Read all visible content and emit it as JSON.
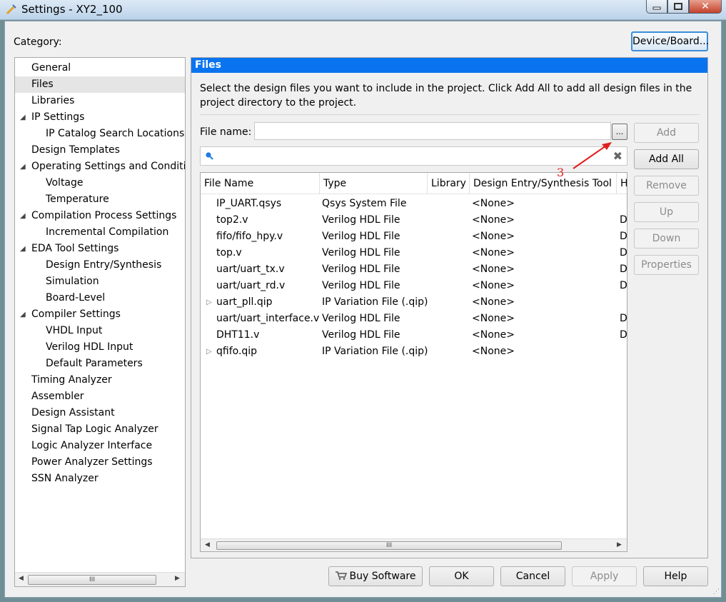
{
  "window": {
    "title": "Settings - XY2_100"
  },
  "category_label": "Category:",
  "device_board_button": "Device/Board...",
  "tree": [
    {
      "label": "General",
      "indent": 0,
      "expander": false,
      "selected": false
    },
    {
      "label": "Files",
      "indent": 0,
      "expander": false,
      "selected": true
    },
    {
      "label": "Libraries",
      "indent": 0,
      "expander": false,
      "selected": false
    },
    {
      "label": "IP Settings",
      "indent": 0,
      "expander": true,
      "selected": false
    },
    {
      "label": "IP Catalog Search Locations",
      "indent": 1,
      "expander": false,
      "selected": false
    },
    {
      "label": "Design Templates",
      "indent": 0,
      "expander": false,
      "selected": false
    },
    {
      "label": "Operating Settings and Conditic",
      "indent": 0,
      "expander": true,
      "selected": false
    },
    {
      "label": "Voltage",
      "indent": 1,
      "expander": false,
      "selected": false
    },
    {
      "label": "Temperature",
      "indent": 1,
      "expander": false,
      "selected": false
    },
    {
      "label": "Compilation Process Settings",
      "indent": 0,
      "expander": true,
      "selected": false
    },
    {
      "label": "Incremental Compilation",
      "indent": 1,
      "expander": false,
      "selected": false
    },
    {
      "label": "EDA Tool Settings",
      "indent": 0,
      "expander": true,
      "selected": false
    },
    {
      "label": "Design Entry/Synthesis",
      "indent": 1,
      "expander": false,
      "selected": false
    },
    {
      "label": "Simulation",
      "indent": 1,
      "expander": false,
      "selected": false
    },
    {
      "label": "Board-Level",
      "indent": 1,
      "expander": false,
      "selected": false
    },
    {
      "label": "Compiler Settings",
      "indent": 0,
      "expander": true,
      "selected": false
    },
    {
      "label": "VHDL Input",
      "indent": 1,
      "expander": false,
      "selected": false
    },
    {
      "label": "Verilog HDL Input",
      "indent": 1,
      "expander": false,
      "selected": false
    },
    {
      "label": "Default Parameters",
      "indent": 1,
      "expander": false,
      "selected": false
    },
    {
      "label": "Timing Analyzer",
      "indent": 0,
      "expander": false,
      "selected": false
    },
    {
      "label": "Assembler",
      "indent": 0,
      "expander": false,
      "selected": false
    },
    {
      "label": "Design Assistant",
      "indent": 0,
      "expander": false,
      "selected": false
    },
    {
      "label": "Signal Tap Logic Analyzer",
      "indent": 0,
      "expander": false,
      "selected": false
    },
    {
      "label": "Logic Analyzer Interface",
      "indent": 0,
      "expander": false,
      "selected": false
    },
    {
      "label": "Power Analyzer Settings",
      "indent": 0,
      "expander": false,
      "selected": false
    },
    {
      "label": "SSN Analyzer",
      "indent": 0,
      "expander": false,
      "selected": false
    }
  ],
  "files_panel": {
    "header": "Files",
    "description": "Select the design files you want to include in the project. Click Add All to add all design files in the project directory to the project.",
    "file_name_label": "File name:",
    "file_name_value": "",
    "browse_label": "...",
    "filter_value": "",
    "buttons": {
      "add": "Add",
      "add_all": "Add All",
      "remove": "Remove",
      "up": "Up",
      "down": "Down",
      "properties": "Properties"
    },
    "columns": [
      "File Name",
      "Type",
      "Library",
      "Design Entry/Synthesis Tool",
      "H"
    ],
    "rows": [
      {
        "name": "IP_UART.qsys",
        "type": "Qsys System File",
        "library": "",
        "tool": "<None>",
        "hdl": "",
        "expander": false
      },
      {
        "name": "top2.v",
        "type": "Verilog HDL File",
        "library": "",
        "tool": "<None>",
        "hdl": "De",
        "expander": false
      },
      {
        "name": "fifo/fifo_hpy.v",
        "type": "Verilog HDL File",
        "library": "",
        "tool": "<None>",
        "hdl": "De",
        "expander": false
      },
      {
        "name": "top.v",
        "type": "Verilog HDL File",
        "library": "",
        "tool": "<None>",
        "hdl": "De",
        "expander": false
      },
      {
        "name": "uart/uart_tx.v",
        "type": "Verilog HDL File",
        "library": "",
        "tool": "<None>",
        "hdl": "De",
        "expander": false
      },
      {
        "name": "uart/uart_rd.v",
        "type": "Verilog HDL File",
        "library": "",
        "tool": "<None>",
        "hdl": "De",
        "expander": false
      },
      {
        "name": "uart_pll.qip",
        "type": "IP Variation File (.qip)",
        "library": "",
        "tool": "<None>",
        "hdl": "",
        "expander": true
      },
      {
        "name": "uart/uart_interface.v",
        "type": "Verilog HDL File",
        "library": "",
        "tool": "<None>",
        "hdl": "De",
        "expander": false
      },
      {
        "name": "DHT11.v",
        "type": "Verilog HDL File",
        "library": "",
        "tool": "<None>",
        "hdl": "De",
        "expander": false
      },
      {
        "name": "qfifo.qip",
        "type": "IP Variation File (.qip)",
        "library": "",
        "tool": "<None>",
        "hdl": "",
        "expander": true
      }
    ],
    "scroll_grip": "III"
  },
  "annotation": {
    "number": "3",
    "color": "#e0201e"
  },
  "bottom_buttons": {
    "buy_software": "Buy Software",
    "ok": "OK",
    "cancel": "Cancel",
    "apply": "Apply",
    "help": "Help"
  },
  "colors": {
    "header_blue": "#0a74f0",
    "focus_blue": "#3b8ed8"
  }
}
